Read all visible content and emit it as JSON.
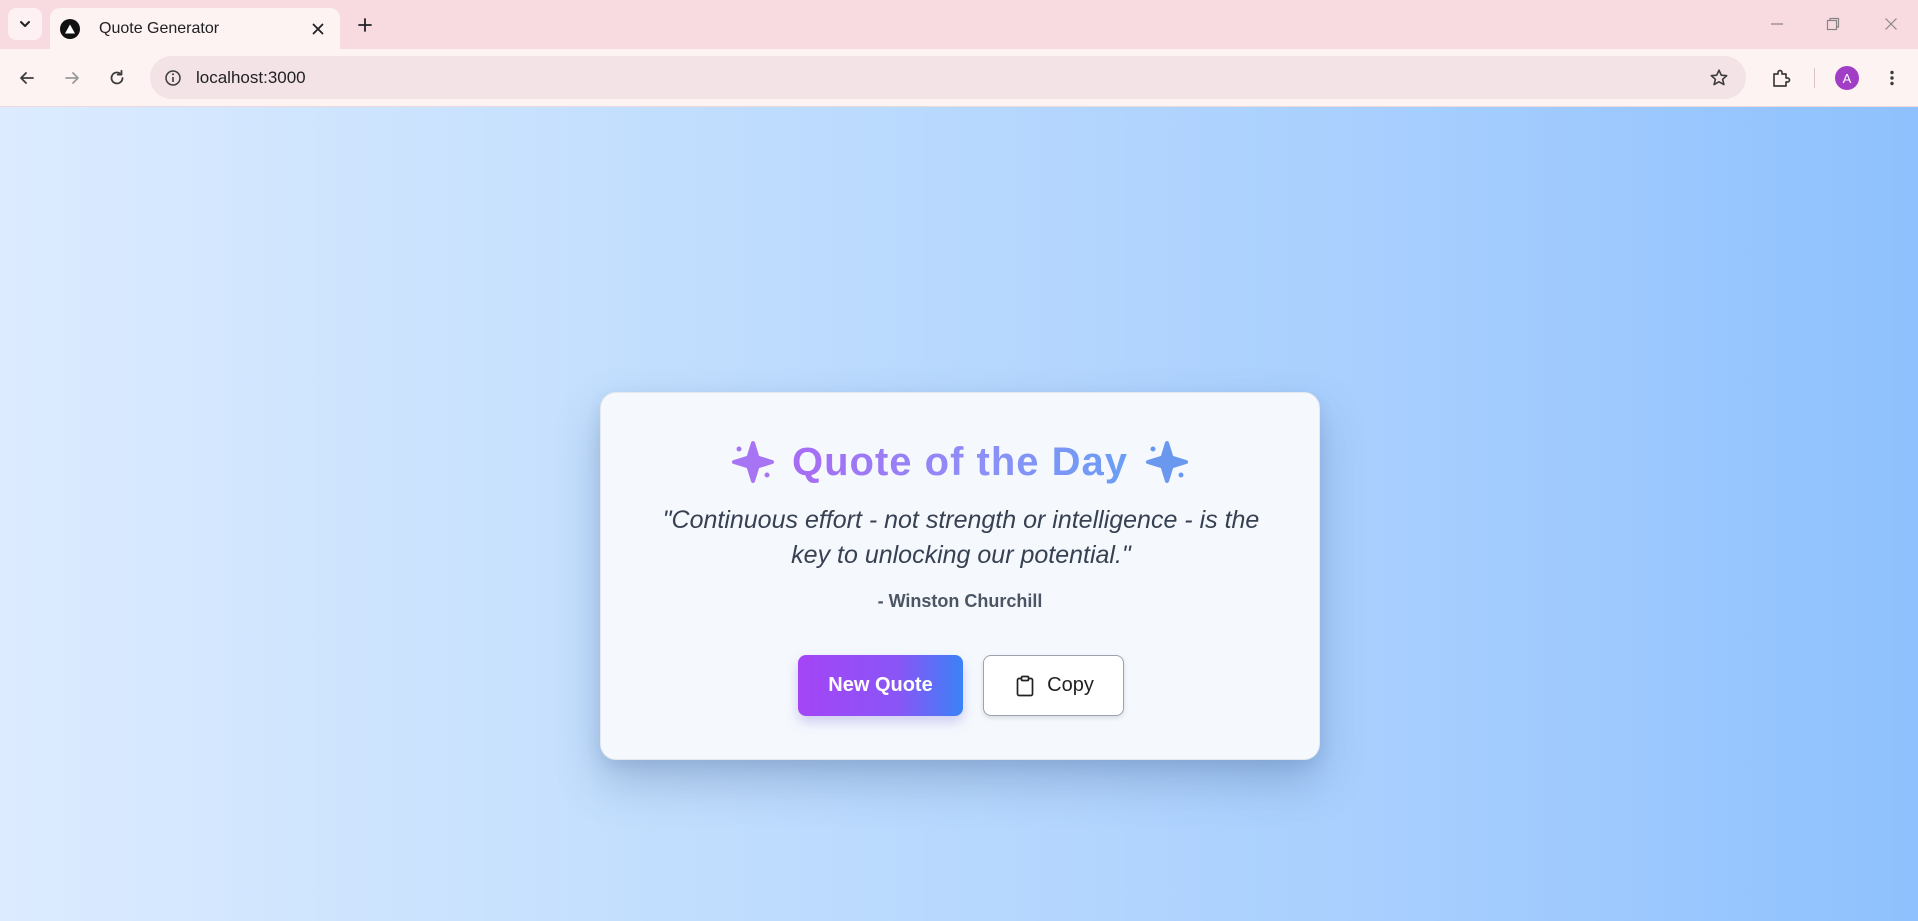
{
  "browser": {
    "tab_title": "Quote Generator",
    "url": "localhost:3000",
    "profile_initial": "A"
  },
  "card": {
    "title": "Quote of the Day",
    "quote": "\"Continuous effort - not strength or intelligence - is the key to unlocking our potential.\"",
    "author": "- Winston Churchill",
    "new_quote_label": "New Quote",
    "copy_label": "Copy"
  },
  "colors": {
    "accent_purple": "#a445f5",
    "accent_blue": "#3b82f6",
    "title_gradient_start": "#a86bf4",
    "title_gradient_end": "#6b9ef5",
    "background_start": "#dcebff",
    "background_end": "#8ec1fd"
  },
  "icons": {
    "header_left": "sparkle-icon",
    "header_right": "sparkle-icon",
    "copy": "clipboard-icon"
  }
}
